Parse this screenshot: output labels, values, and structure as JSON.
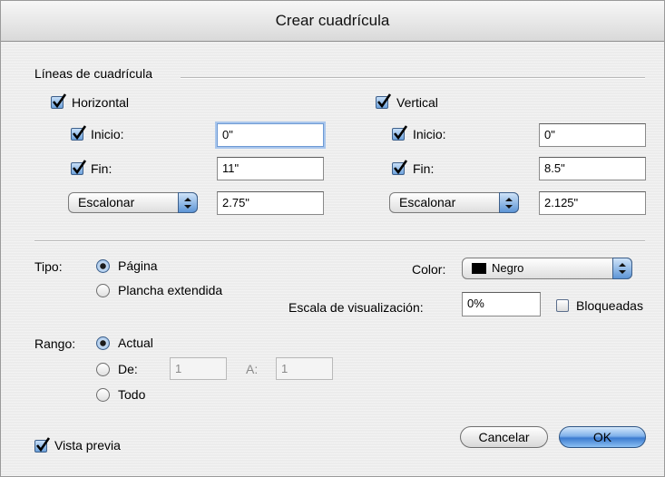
{
  "window": {
    "title": "Crear cuadrícula"
  },
  "grid_lines": {
    "group_label": "Líneas de cuadrícula",
    "horizontal": {
      "label": "Horizontal",
      "checked": true,
      "start_label": "Inicio:",
      "start_value": "0\"",
      "end_label": "Fin:",
      "end_value": "11\"",
      "mode_label": "Escalonar",
      "mode_value": "2.75\""
    },
    "vertical": {
      "label": "Vertical",
      "checked": true,
      "start_label": "Inicio:",
      "start_value": "0\"",
      "end_label": "Fin:",
      "end_value": "8.5\"",
      "mode_label": "Escalonar",
      "mode_value": "2.125\""
    }
  },
  "type": {
    "label": "Tipo:",
    "options": [
      {
        "label": "Página",
        "selected": true
      },
      {
        "label": "Plancha extendida",
        "selected": false
      }
    ]
  },
  "color": {
    "label": "Color:",
    "value": "Negro",
    "swatch": "#000000"
  },
  "view_scale": {
    "label": "Escala de visualización:",
    "value": "0%"
  },
  "locked": {
    "label": "Bloqueadas",
    "checked": false
  },
  "range": {
    "label": "Rango:",
    "current_label": "Actual",
    "from_label": "De:",
    "from_value": "1",
    "to_label": "A:",
    "to_value": "1",
    "all_label": "Todo"
  },
  "preview": {
    "label": "Vista previa",
    "checked": true
  },
  "buttons": {
    "cancel": "Cancelar",
    "ok": "OK"
  },
  "colors": {
    "accent": "#5d95d6",
    "window_bg": "#ececec"
  }
}
